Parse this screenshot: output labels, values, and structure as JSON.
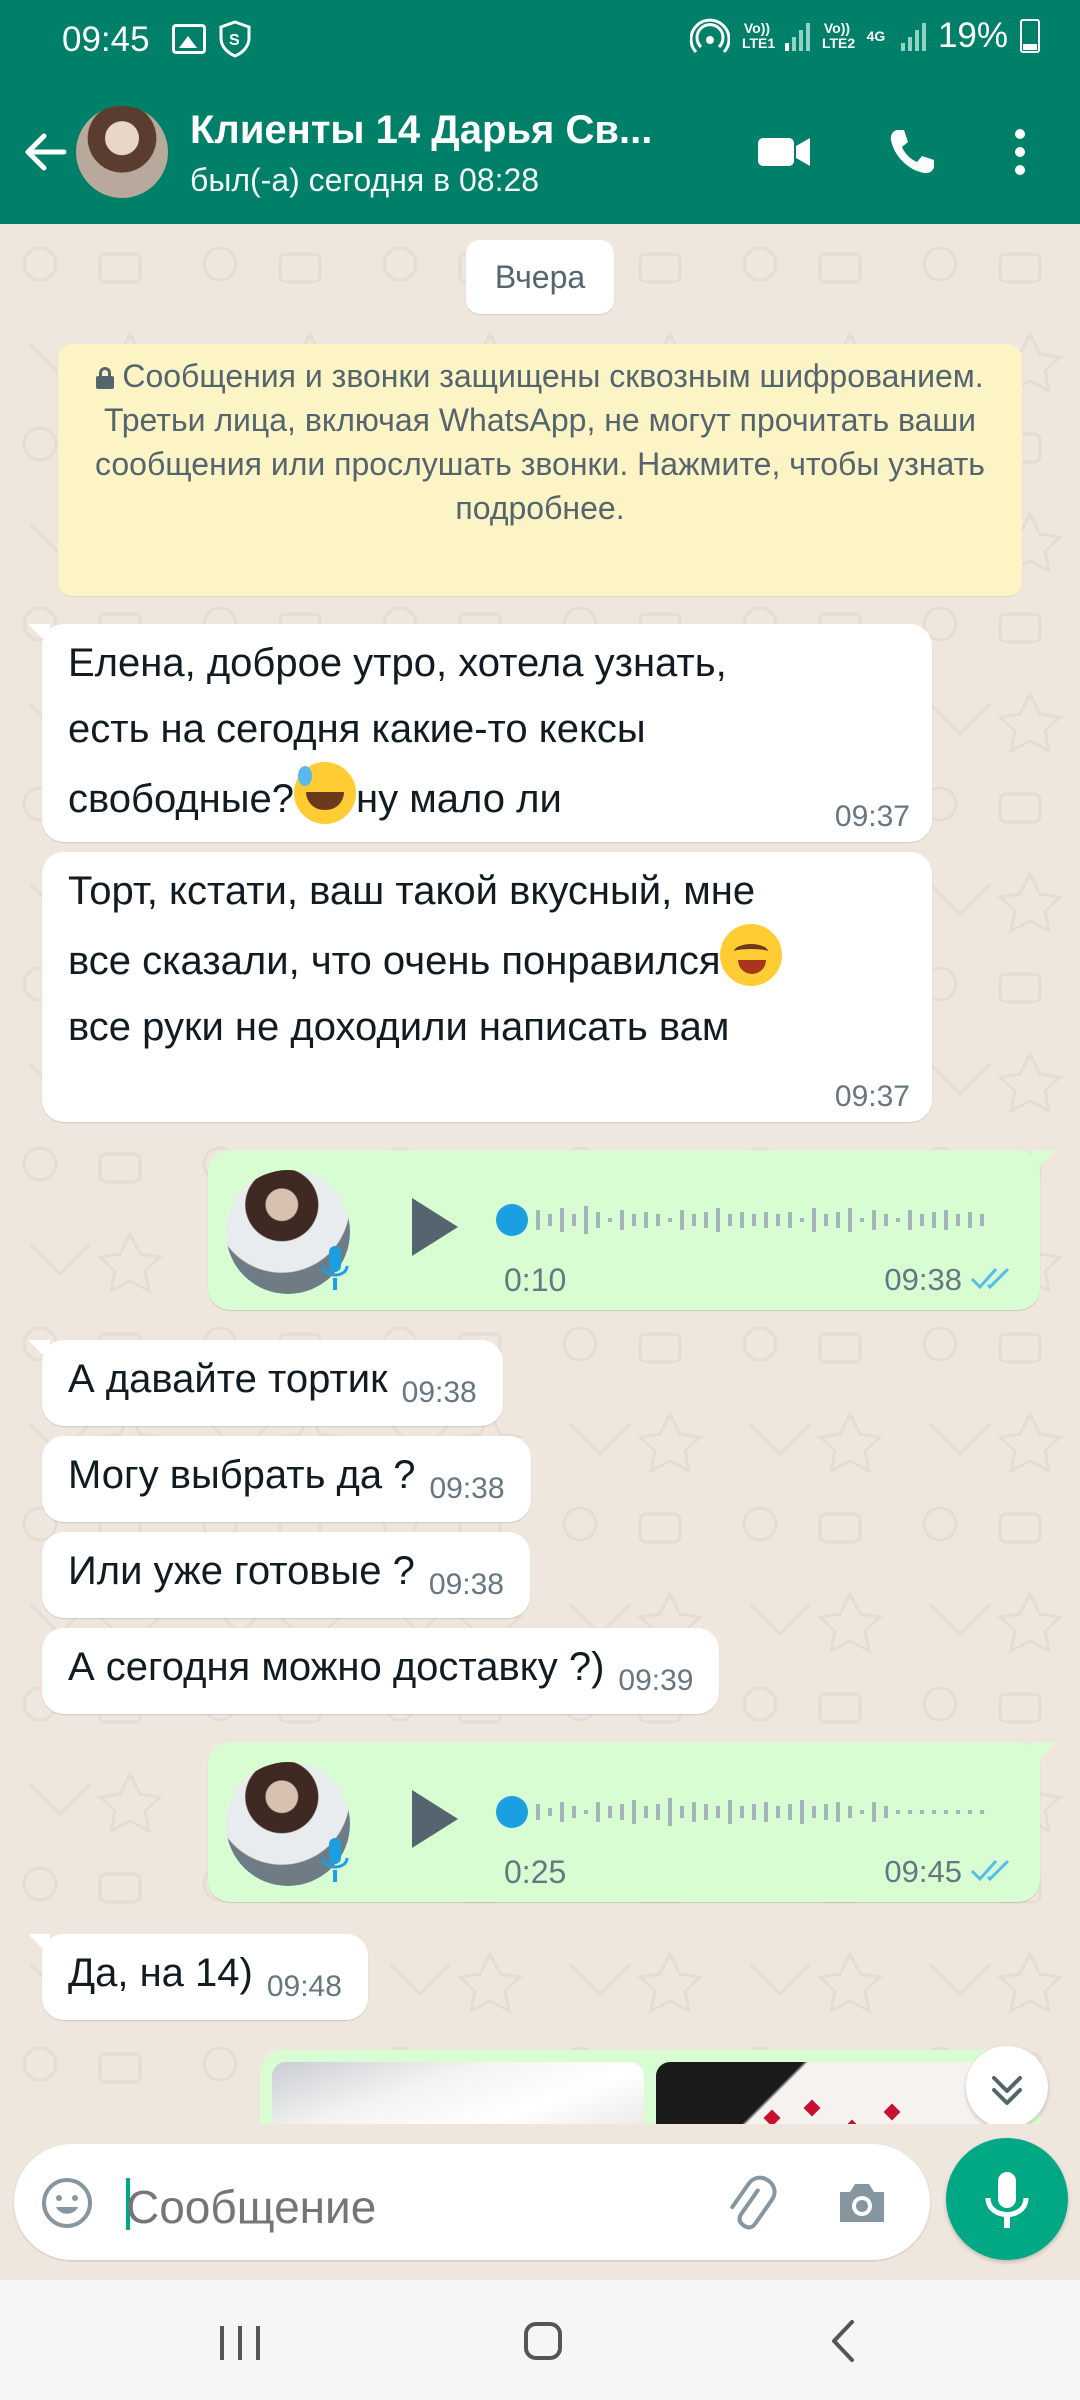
{
  "status_bar": {
    "time": "09:45",
    "sim1": "Vo)) LTE1",
    "sim2": "Vo)) LTE2",
    "net": "4G",
    "battery": "19%",
    "icons": [
      "image-icon",
      "shield-s-icon",
      "hotspot-icon",
      "signal-icon",
      "battery-icon"
    ]
  },
  "header": {
    "title": "Клиенты 14 Дарья Св...",
    "subtitle": "был(-а) сегодня в 08:28",
    "icons": [
      "back-arrow-icon",
      "video-call-icon",
      "phone-icon",
      "more-vert-icon"
    ]
  },
  "chat": {
    "date_chip": "Вчера",
    "encryption_notice": "Сообщения и звонки защищены сквозным шифрованием. Третьи лица, включая WhatsApp, не могут прочитать ваши сообщения или прослушать звонки. Нажмите, чтобы узнать подробнее.",
    "messages": [
      {
        "dir": "in",
        "text_a": "Елена, доброе утро, хотела узнать,\nесть на сегодня какие-то кексы\nсвободные?",
        "emoji": "sweat-smile-emoji",
        "text_b": "ну мало ли",
        "time": "09:37"
      },
      {
        "dir": "in",
        "text_a": "Торт, кстати, ваш такой вкусный, мне\nвсе сказали, что очень понравился",
        "emoji": "drooling-face-emoji",
        "text_b": "\nвсе руки не доходили написать вам",
        "time": "09:37"
      },
      {
        "dir": "out",
        "type": "voice",
        "duration": "0:10",
        "time": "09:38",
        "status": "read"
      },
      {
        "dir": "in",
        "text": "А давайте тортик",
        "time": "09:38"
      },
      {
        "dir": "in",
        "text": "Могу выбрать да ?",
        "time": "09:38"
      },
      {
        "dir": "in",
        "text": "Или уже готовые ?",
        "time": "09:38"
      },
      {
        "dir": "in",
        "text": "А сегодня можно доставку ?)",
        "time": "09:39"
      },
      {
        "dir": "out",
        "type": "voice",
        "duration": "0:25",
        "time": "09:45",
        "status": "read"
      },
      {
        "dir": "in",
        "text": "Да, на 14)",
        "time": "09:48"
      },
      {
        "dir": "out",
        "type": "images",
        "count": 2
      }
    ]
  },
  "input": {
    "placeholder": "Сообщение",
    "icons": [
      "emoji-icon",
      "attach-icon",
      "camera-icon",
      "mic-icon"
    ]
  },
  "navbar": {
    "icons": [
      "recent-apps-icon",
      "home-icon",
      "back-icon"
    ]
  },
  "colors": {
    "brand": "#008069",
    "accent": "#00a884",
    "out_bubble": "#d9fdd3",
    "read_ticks": "#53bdeb",
    "voice_dot": "#1c9fe0"
  }
}
